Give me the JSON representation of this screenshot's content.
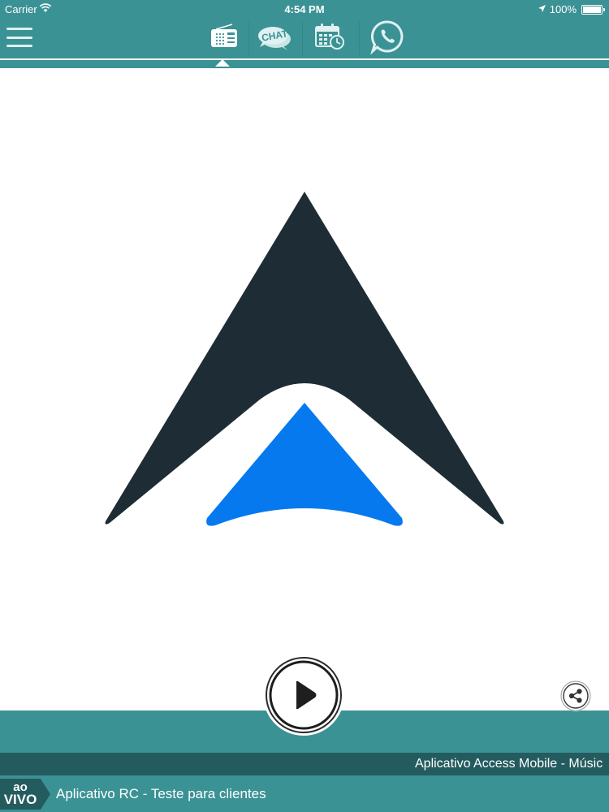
{
  "status_bar": {
    "carrier": "Carrier",
    "time": "4:54 PM",
    "battery": "100%"
  },
  "top_nav": {
    "tabs": [
      {
        "icon": "radio-icon",
        "active": true
      },
      {
        "icon": "chat-icon",
        "label": "CHAT"
      },
      {
        "icon": "calendar-icon"
      },
      {
        "icon": "whatsapp-icon"
      }
    ]
  },
  "logo": {
    "icon": "access-mobile-logo",
    "colors": {
      "dark": "#1e2d35",
      "accent": "#0679ef"
    }
  },
  "player": {
    "ticker_text": "Aplicativo Access Mobile - Músic",
    "live_badge": {
      "line1": "ao",
      "line2": "VIVO"
    },
    "now_playing": "Aplicativo RC - Teste para clientes"
  },
  "theme": {
    "primary": "#3b9295",
    "dark": "#245b5f"
  }
}
